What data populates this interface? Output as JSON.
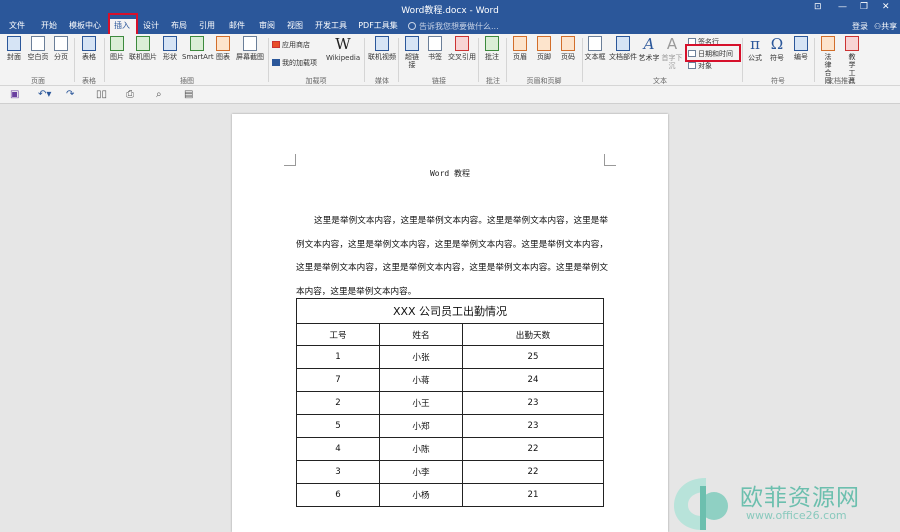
{
  "window": {
    "title": "Word教程.docx - Word",
    "controls": [
      "⊡",
      "—",
      "❐",
      "✕"
    ]
  },
  "tabs": [
    "文件",
    "开始",
    "模板中心",
    "插入",
    "设计",
    "布局",
    "引用",
    "邮件",
    "审阅",
    "视图",
    "开发工具",
    "PDF工具集"
  ],
  "active_tab": "插入",
  "tell_me": "告诉我您想要做什么...",
  "account": {
    "login": "登录",
    "share": "共享"
  },
  "ribbon": {
    "pages": {
      "cover": "封面",
      "blank": "空白页",
      "break": "分页",
      "group": "页面"
    },
    "tables": {
      "table": "表格",
      "group": "表格"
    },
    "illustrations": {
      "picture": "图片",
      "online_picture": "联机图片",
      "shapes": "形状",
      "smartart": "SmartArt",
      "chart": "图表",
      "screenshot": "屏幕截图",
      "group": "插图"
    },
    "addins": {
      "store": "应用商店",
      "my_addins": "我的加载项",
      "wikipedia": "Wikipedia",
      "group": "加载项"
    },
    "media": {
      "online_video": "联机视频",
      "group": "媒体"
    },
    "links": {
      "hyperlink": "超链接",
      "bookmark": "书签",
      "crossref": "交叉引用",
      "group": "链接"
    },
    "comments": {
      "comment": "批注",
      "group": "批注"
    },
    "header_footer": {
      "header": "页眉",
      "footer": "页脚",
      "page_number": "页码",
      "group": "页眉和页脚"
    },
    "text": {
      "textbox": "文本框",
      "quickparts": "文档部件",
      "wordart": "艺术字",
      "dropcap": "首字下沉",
      "signature": "签名行",
      "datetime": "日期和时间",
      "object": "对象",
      "group": "文本"
    },
    "symbols": {
      "equation": "公式",
      "symbol": "符号",
      "numbering": "编号",
      "group": "符号"
    },
    "doc_recommend": {
      "legal": "法律合同",
      "teaching": "教学工具",
      "group": "文档推荐"
    }
  },
  "document": {
    "header": "Word 教程",
    "paragraph": "这里是举例文本内容，这里是举例文本内容。这里是举例文本内容，这里是举例文本内容，这里是举例文本内容，这里是举例文本内容。这里是举例文本内容，这里是举例文本内容，这里是举例文本内容，这里是举例文本内容。这里是举例文本内容，这里是举例文本内容。",
    "table": {
      "caption": "XXX 公司员工出勤情况",
      "headers": [
        "工号",
        "姓名",
        "出勤天数"
      ],
      "rows": [
        [
          "1",
          "小张",
          "25"
        ],
        [
          "7",
          "小蒋",
          "24"
        ],
        [
          "2",
          "小王",
          "23"
        ],
        [
          "5",
          "小郑",
          "23"
        ],
        [
          "4",
          "小陈",
          "22"
        ],
        [
          "3",
          "小李",
          "22"
        ],
        [
          "6",
          "小杨",
          "21"
        ]
      ]
    }
  },
  "watermark": {
    "name": "欧菲资源网",
    "url": "www.office26.com"
  },
  "colors": {
    "title_bar": "#2b579a",
    "highlight": "#d6102b",
    "watermark": "#6cbfae"
  }
}
